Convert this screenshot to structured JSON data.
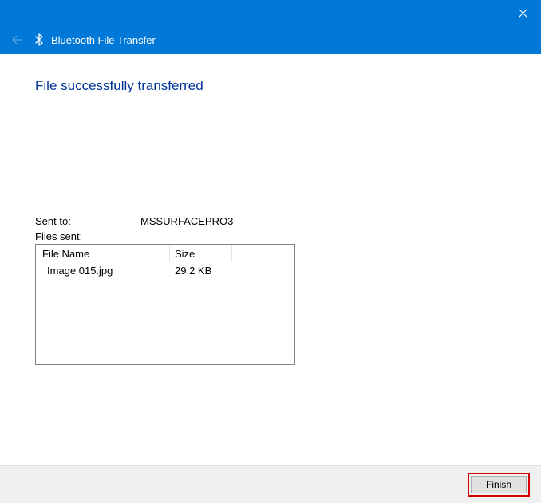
{
  "window": {
    "title": "Bluetooth File Transfer"
  },
  "heading": "File successfully transferred",
  "sent_to": {
    "label": "Sent to:",
    "value": "MSSURFACEPRO3"
  },
  "files_sent_label": "Files sent:",
  "table": {
    "headers": {
      "name": "File Name",
      "size": "Size"
    },
    "rows": [
      {
        "name": "Image 015.jpg",
        "size": "29.2 KB"
      }
    ]
  },
  "buttons": {
    "finish": "Finish"
  }
}
